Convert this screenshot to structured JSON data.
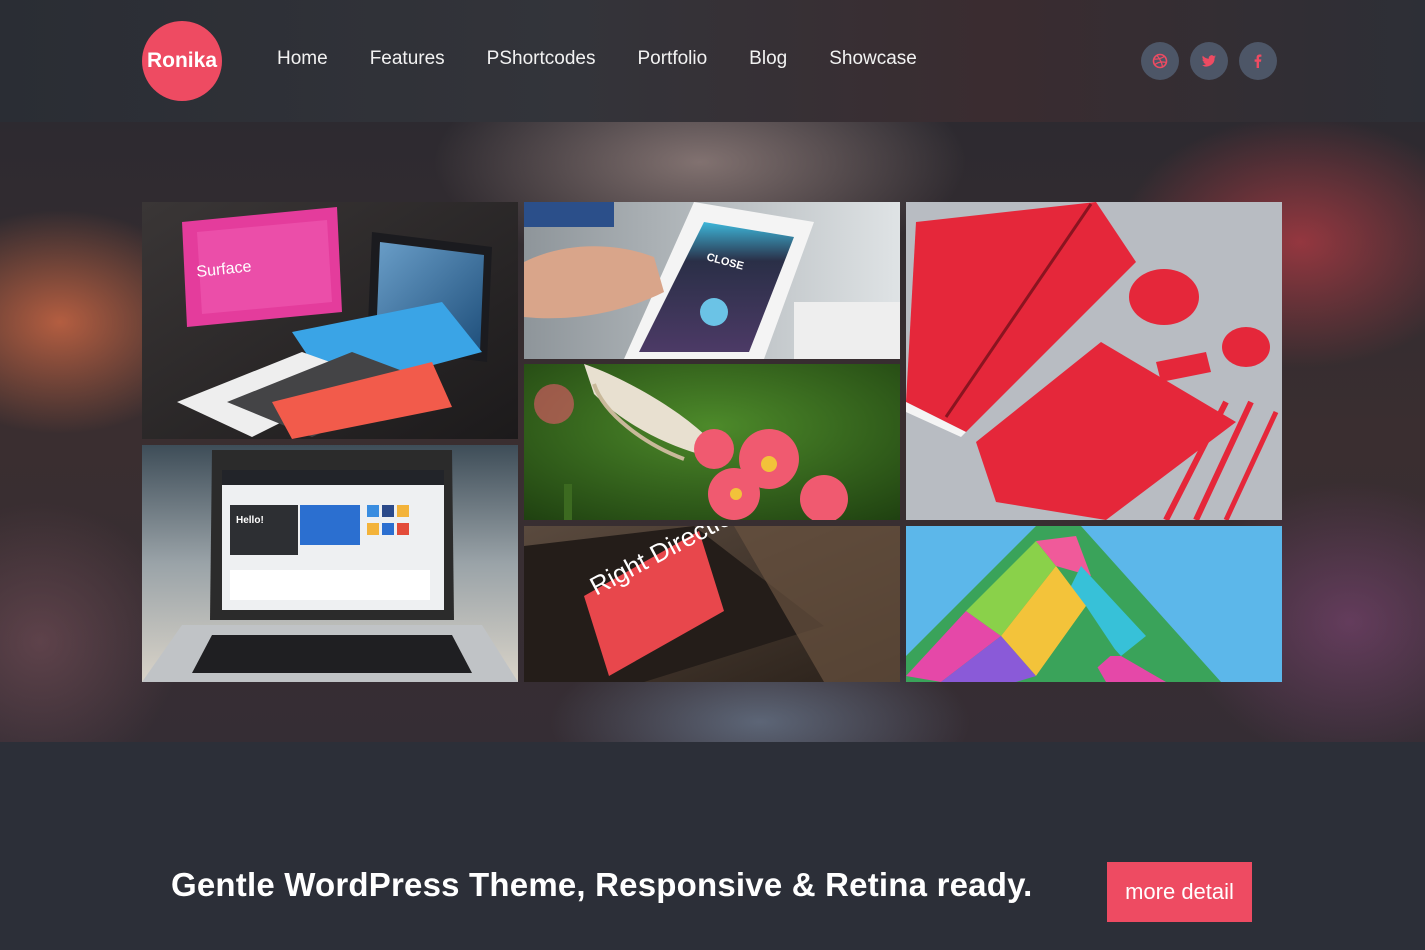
{
  "brand": {
    "logo_text": "Ronika",
    "accent": "#ee4b62"
  },
  "nav": {
    "items": [
      {
        "label": "Home"
      },
      {
        "label": "Features"
      },
      {
        "label": "PShortcodes"
      },
      {
        "label": "Portfolio"
      },
      {
        "label": "Blog"
      },
      {
        "label": "Showcase"
      }
    ]
  },
  "social": [
    {
      "icon": "dribbble-icon"
    },
    {
      "icon": "twitter-icon"
    },
    {
      "icon": "facebook-icon"
    }
  ],
  "portfolio": {
    "tiles": [
      {
        "icon": "tablet-keyboards-image",
        "caption": "Surface"
      },
      {
        "icon": "smartphone-app-image",
        "caption": "CLOSE"
      },
      {
        "icon": "red-stationery-image",
        "caption": ""
      },
      {
        "icon": "butterfly-flower-image",
        "caption": ""
      },
      {
        "icon": "laptop-website-image",
        "caption": "Hello!"
      },
      {
        "icon": "brochure-image",
        "caption": "Right Direction"
      },
      {
        "icon": "colorful-building-image",
        "caption": ""
      }
    ]
  },
  "promo": {
    "tagline": "Gentle WordPress Theme, Responsive & Retina ready.",
    "button_label": "more detail"
  }
}
